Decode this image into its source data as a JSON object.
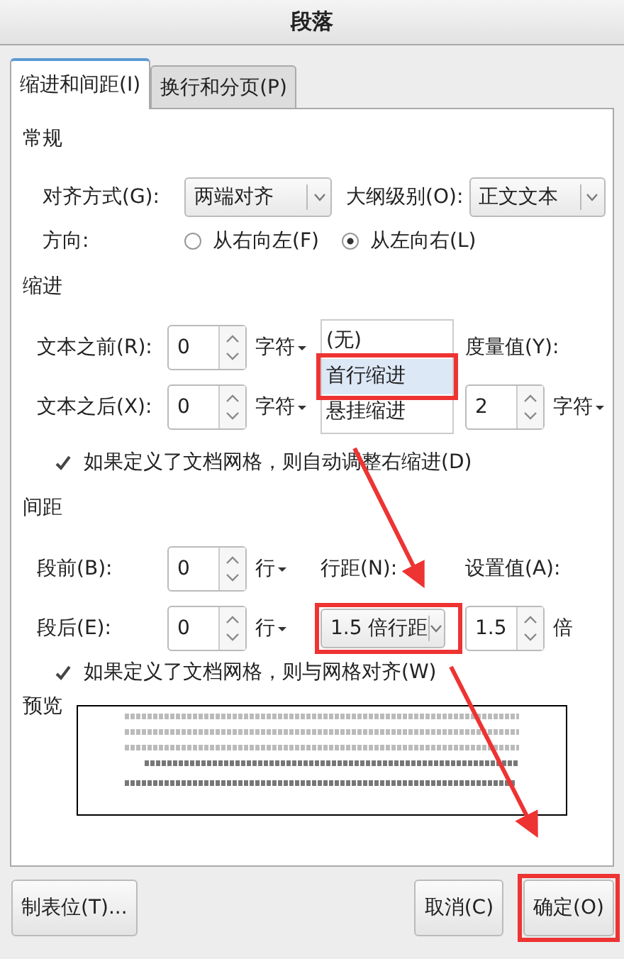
{
  "window": {
    "title": "段落"
  },
  "tabs": [
    {
      "label": "缩进和间距(I)",
      "selected": true
    },
    {
      "label": "换行和分页(P)",
      "selected": false
    }
  ],
  "general": {
    "heading": "常规",
    "alignment": {
      "label": "对齐方式(G):",
      "value": "两端对齐"
    },
    "outline_level": {
      "label": "大纲级别(O):",
      "value": "正文文本"
    },
    "direction": {
      "label": "方向:",
      "options": [
        {
          "label": "从右向左(F)",
          "selected": false
        },
        {
          "label": "从左向右(L)",
          "selected": true
        }
      ]
    }
  },
  "indent": {
    "heading": "缩进",
    "before": {
      "label": "文本之前(R):",
      "value": "0",
      "unit": "字符"
    },
    "after": {
      "label": "文本之后(X):",
      "value": "0",
      "unit": "字符"
    },
    "measure": {
      "label": "度量值(Y):",
      "value": "2",
      "unit": "字符"
    },
    "first_line_menu": [
      {
        "label": "(无)",
        "selected": false
      },
      {
        "label": "首行缩进",
        "selected": true
      },
      {
        "label": "悬挂缩进",
        "selected": false
      }
    ],
    "auto_adjust": {
      "label": "如果定义了文档网格，则自动调整右缩进(D)",
      "checked": true
    }
  },
  "spacing": {
    "heading": "间距",
    "before": {
      "label": "段前(B):",
      "value": "0",
      "unit": "行"
    },
    "after": {
      "label": "段后(E):",
      "value": "0",
      "unit": "行"
    },
    "line_spacing": {
      "label": "行距(N):",
      "value": "1.5 倍行距"
    },
    "setting": {
      "label": "设置值(A):",
      "value": "1.5",
      "unit": "倍"
    },
    "snap_to_grid": {
      "label": "如果定义了文档网格，则与网格对齐(W)",
      "checked": true
    }
  },
  "preview": {
    "heading": "预览"
  },
  "buttons": {
    "tab_stops": "制表位(T)...",
    "cancel": "取消(C)",
    "ok": "确定(O)"
  }
}
